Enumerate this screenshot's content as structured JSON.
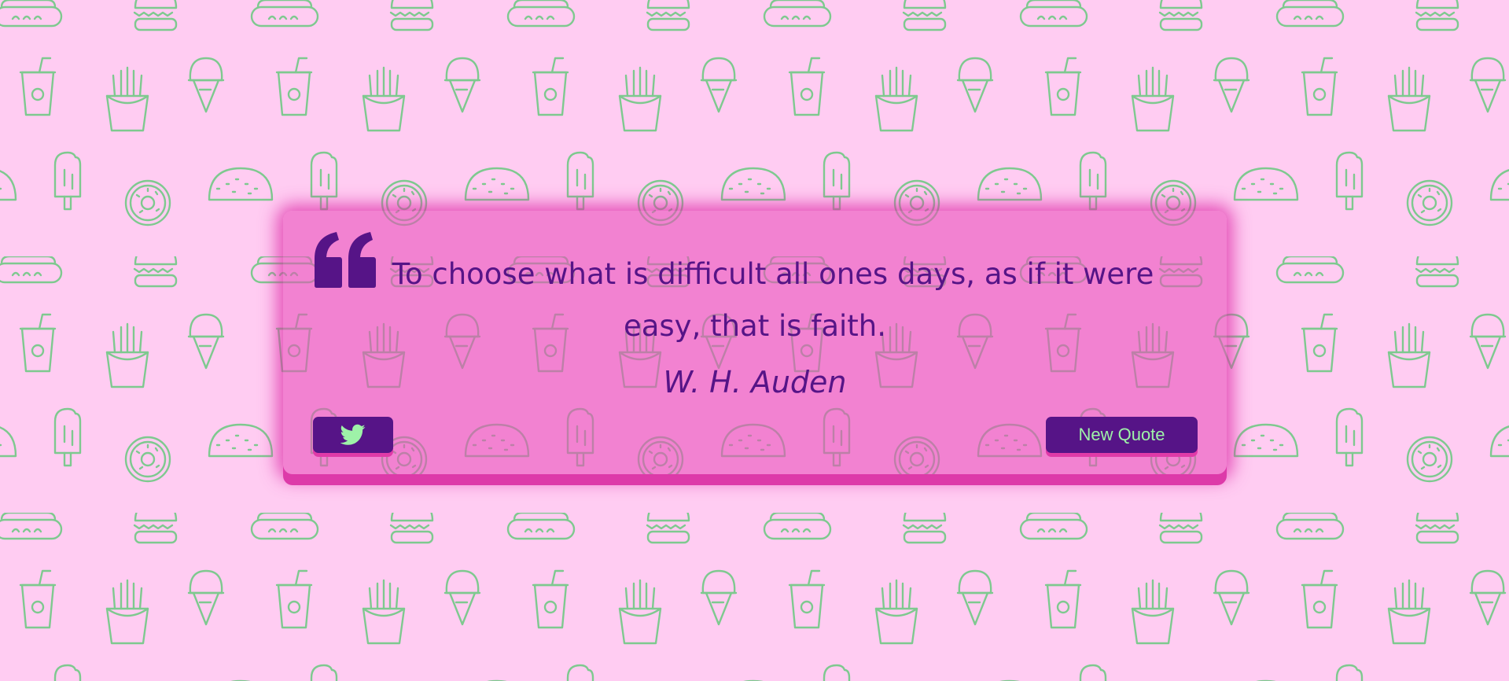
{
  "quote": {
    "text": "To choose what is difficult all ones days, as if it were easy, that is faith.",
    "author": "W. H. Auden"
  },
  "buttons": {
    "tweet_icon": "twitter-icon",
    "new_quote_label": "New Quote"
  },
  "icons": {
    "quote_mark": "quote-icon",
    "background_pattern": [
      "hotdog-icon",
      "burger-icon",
      "drink-cup-icon",
      "fries-icon",
      "ice-cream-cone-icon",
      "popsicle-icon",
      "taco-icon",
      "donut-icon"
    ]
  },
  "colors": {
    "background": "#ffccf2",
    "pattern": "#7ec98f",
    "card": "#ee7fcb",
    "accent": "#561487",
    "button_text": "#9ef2a8",
    "shadow": "#dd3aa9"
  }
}
